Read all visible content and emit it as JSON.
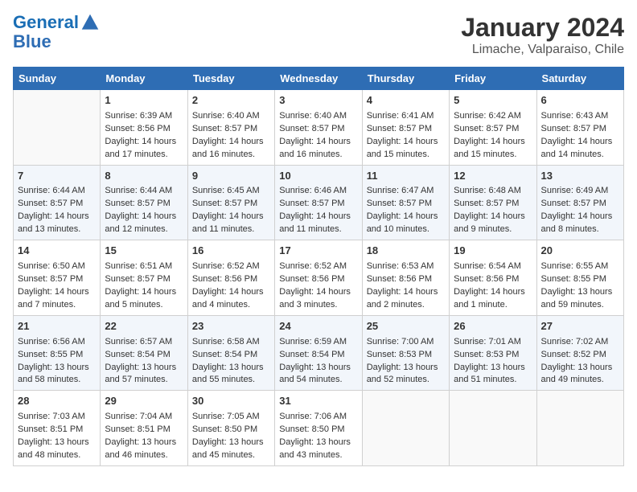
{
  "header": {
    "logo_line1": "General",
    "logo_line2": "Blue",
    "month": "January 2024",
    "location": "Limache, Valparaiso, Chile"
  },
  "days_of_week": [
    "Sunday",
    "Monday",
    "Tuesday",
    "Wednesday",
    "Thursday",
    "Friday",
    "Saturday"
  ],
  "weeks": [
    [
      {
        "day": "",
        "empty": true
      },
      {
        "day": "1",
        "sunrise": "Sunrise: 6:39 AM",
        "sunset": "Sunset: 8:56 PM",
        "daylight": "Daylight: 14 hours and 17 minutes."
      },
      {
        "day": "2",
        "sunrise": "Sunrise: 6:40 AM",
        "sunset": "Sunset: 8:57 PM",
        "daylight": "Daylight: 14 hours and 16 minutes."
      },
      {
        "day": "3",
        "sunrise": "Sunrise: 6:40 AM",
        "sunset": "Sunset: 8:57 PM",
        "daylight": "Daylight: 14 hours and 16 minutes."
      },
      {
        "day": "4",
        "sunrise": "Sunrise: 6:41 AM",
        "sunset": "Sunset: 8:57 PM",
        "daylight": "Daylight: 14 hours and 15 minutes."
      },
      {
        "day": "5",
        "sunrise": "Sunrise: 6:42 AM",
        "sunset": "Sunset: 8:57 PM",
        "daylight": "Daylight: 14 hours and 15 minutes."
      },
      {
        "day": "6",
        "sunrise": "Sunrise: 6:43 AM",
        "sunset": "Sunset: 8:57 PM",
        "daylight": "Daylight: 14 hours and 14 minutes."
      }
    ],
    [
      {
        "day": "7",
        "sunrise": "Sunrise: 6:44 AM",
        "sunset": "Sunset: 8:57 PM",
        "daylight": "Daylight: 14 hours and 13 minutes."
      },
      {
        "day": "8",
        "sunrise": "Sunrise: 6:44 AM",
        "sunset": "Sunset: 8:57 PM",
        "daylight": "Daylight: 14 hours and 12 minutes."
      },
      {
        "day": "9",
        "sunrise": "Sunrise: 6:45 AM",
        "sunset": "Sunset: 8:57 PM",
        "daylight": "Daylight: 14 hours and 11 minutes."
      },
      {
        "day": "10",
        "sunrise": "Sunrise: 6:46 AM",
        "sunset": "Sunset: 8:57 PM",
        "daylight": "Daylight: 14 hours and 11 minutes."
      },
      {
        "day": "11",
        "sunrise": "Sunrise: 6:47 AM",
        "sunset": "Sunset: 8:57 PM",
        "daylight": "Daylight: 14 hours and 10 minutes."
      },
      {
        "day": "12",
        "sunrise": "Sunrise: 6:48 AM",
        "sunset": "Sunset: 8:57 PM",
        "daylight": "Daylight: 14 hours and 9 minutes."
      },
      {
        "day": "13",
        "sunrise": "Sunrise: 6:49 AM",
        "sunset": "Sunset: 8:57 PM",
        "daylight": "Daylight: 14 hours and 8 minutes."
      }
    ],
    [
      {
        "day": "14",
        "sunrise": "Sunrise: 6:50 AM",
        "sunset": "Sunset: 8:57 PM",
        "daylight": "Daylight: 14 hours and 7 minutes."
      },
      {
        "day": "15",
        "sunrise": "Sunrise: 6:51 AM",
        "sunset": "Sunset: 8:57 PM",
        "daylight": "Daylight: 14 hours and 5 minutes."
      },
      {
        "day": "16",
        "sunrise": "Sunrise: 6:52 AM",
        "sunset": "Sunset: 8:56 PM",
        "daylight": "Daylight: 14 hours and 4 minutes."
      },
      {
        "day": "17",
        "sunrise": "Sunrise: 6:52 AM",
        "sunset": "Sunset: 8:56 PM",
        "daylight": "Daylight: 14 hours and 3 minutes."
      },
      {
        "day": "18",
        "sunrise": "Sunrise: 6:53 AM",
        "sunset": "Sunset: 8:56 PM",
        "daylight": "Daylight: 14 hours and 2 minutes."
      },
      {
        "day": "19",
        "sunrise": "Sunrise: 6:54 AM",
        "sunset": "Sunset: 8:56 PM",
        "daylight": "Daylight: 14 hours and 1 minute."
      },
      {
        "day": "20",
        "sunrise": "Sunrise: 6:55 AM",
        "sunset": "Sunset: 8:55 PM",
        "daylight": "Daylight: 13 hours and 59 minutes."
      }
    ],
    [
      {
        "day": "21",
        "sunrise": "Sunrise: 6:56 AM",
        "sunset": "Sunset: 8:55 PM",
        "daylight": "Daylight: 13 hours and 58 minutes."
      },
      {
        "day": "22",
        "sunrise": "Sunrise: 6:57 AM",
        "sunset": "Sunset: 8:54 PM",
        "daylight": "Daylight: 13 hours and 57 minutes."
      },
      {
        "day": "23",
        "sunrise": "Sunrise: 6:58 AM",
        "sunset": "Sunset: 8:54 PM",
        "daylight": "Daylight: 13 hours and 55 minutes."
      },
      {
        "day": "24",
        "sunrise": "Sunrise: 6:59 AM",
        "sunset": "Sunset: 8:54 PM",
        "daylight": "Daylight: 13 hours and 54 minutes."
      },
      {
        "day": "25",
        "sunrise": "Sunrise: 7:00 AM",
        "sunset": "Sunset: 8:53 PM",
        "daylight": "Daylight: 13 hours and 52 minutes."
      },
      {
        "day": "26",
        "sunrise": "Sunrise: 7:01 AM",
        "sunset": "Sunset: 8:53 PM",
        "daylight": "Daylight: 13 hours and 51 minutes."
      },
      {
        "day": "27",
        "sunrise": "Sunrise: 7:02 AM",
        "sunset": "Sunset: 8:52 PM",
        "daylight": "Daylight: 13 hours and 49 minutes."
      }
    ],
    [
      {
        "day": "28",
        "sunrise": "Sunrise: 7:03 AM",
        "sunset": "Sunset: 8:51 PM",
        "daylight": "Daylight: 13 hours and 48 minutes."
      },
      {
        "day": "29",
        "sunrise": "Sunrise: 7:04 AM",
        "sunset": "Sunset: 8:51 PM",
        "daylight": "Daylight: 13 hours and 46 minutes."
      },
      {
        "day": "30",
        "sunrise": "Sunrise: 7:05 AM",
        "sunset": "Sunset: 8:50 PM",
        "daylight": "Daylight: 13 hours and 45 minutes."
      },
      {
        "day": "31",
        "sunrise": "Sunrise: 7:06 AM",
        "sunset": "Sunset: 8:50 PM",
        "daylight": "Daylight: 13 hours and 43 minutes."
      },
      {
        "day": "",
        "empty": true
      },
      {
        "day": "",
        "empty": true
      },
      {
        "day": "",
        "empty": true
      }
    ]
  ]
}
